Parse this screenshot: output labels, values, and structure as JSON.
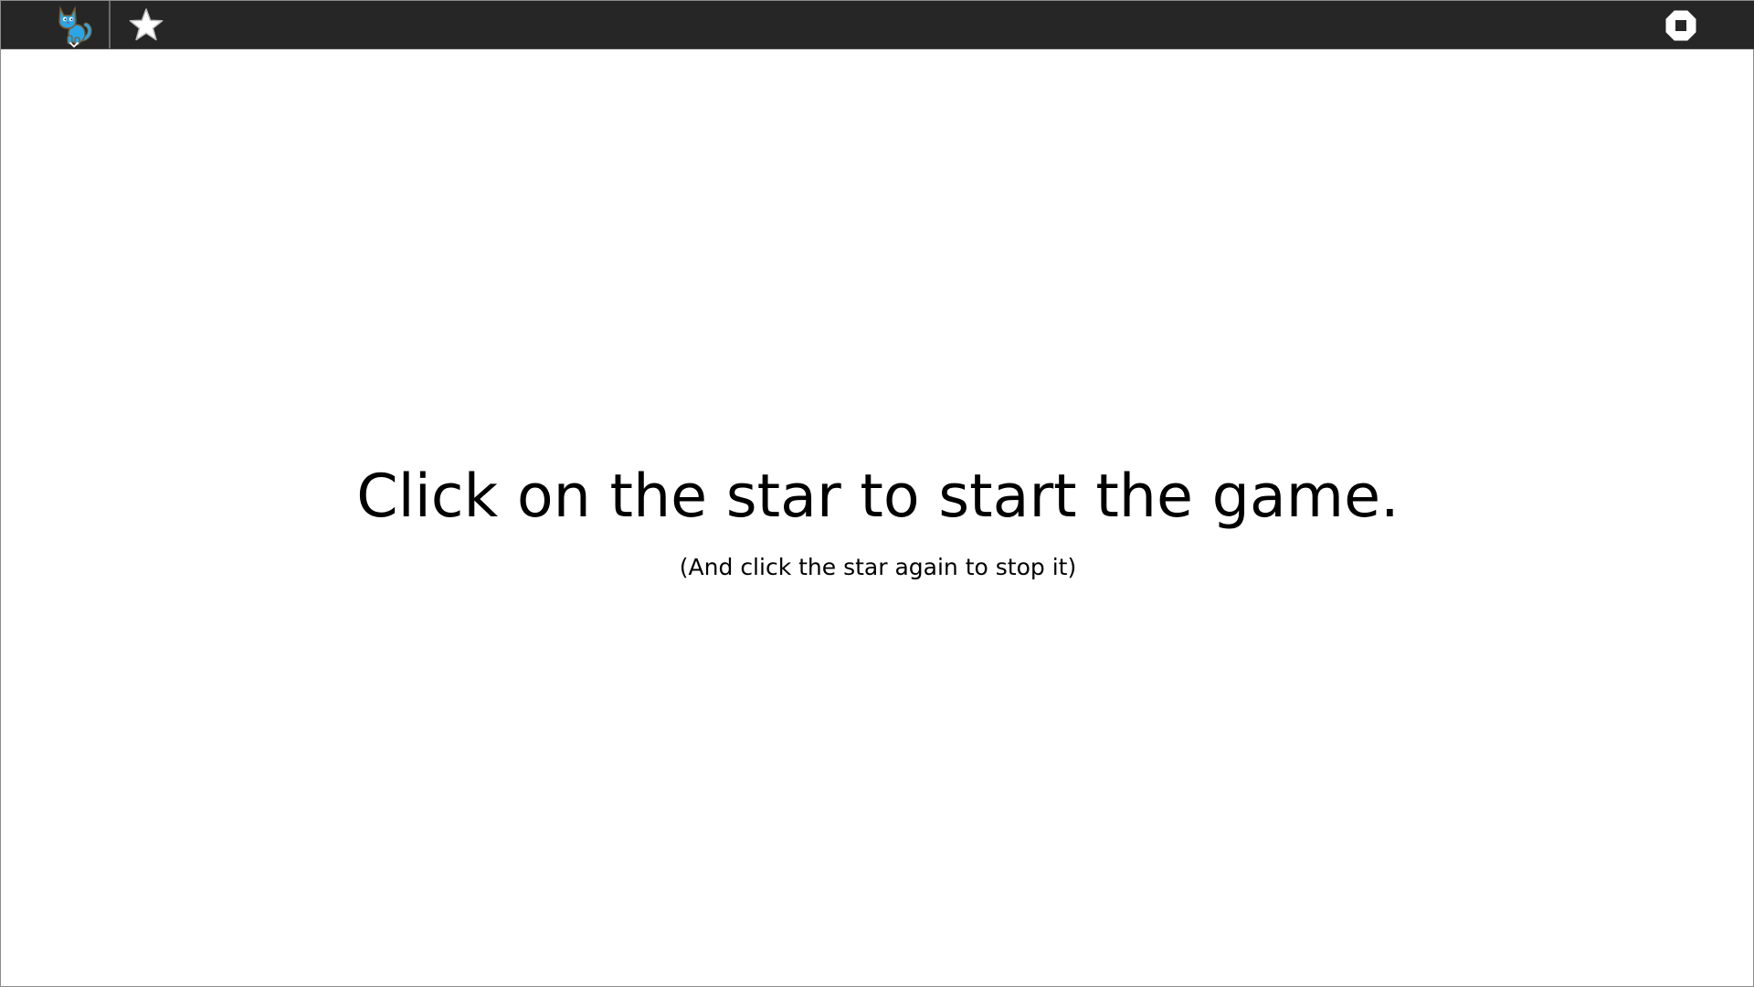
{
  "toolbar": {
    "background": "#262626",
    "menu_icon": "cat-icon",
    "menu_caret_icon": "chevron-down-icon",
    "start_icon": "star-icon",
    "stop_icon": "stop-icon"
  },
  "message": {
    "title": "Click on the star to start the game.",
    "subtitle": "(And click the star again to stop it)"
  },
  "colors": {
    "cat_blue": "#2aa6e8",
    "cat_outline": "#7a5a2e",
    "icon_white": "#ffffff"
  }
}
